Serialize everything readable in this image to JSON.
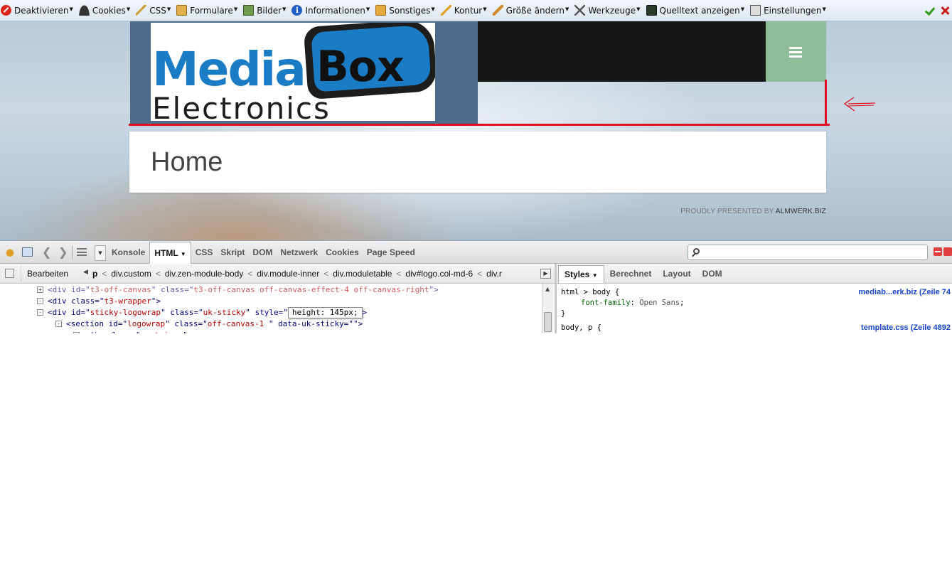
{
  "webdev_toolbar": {
    "items": [
      {
        "label": "Deaktivieren",
        "icon": "disable-icon"
      },
      {
        "label": "Cookies",
        "icon": "cookie-icon"
      },
      {
        "label": "CSS",
        "icon": "css-wand-icon"
      },
      {
        "label": "Formulare",
        "icon": "form-icon"
      },
      {
        "label": "Bilder",
        "icon": "image-icon"
      },
      {
        "label": "Informationen",
        "icon": "info-icon"
      },
      {
        "label": "Sonstiges",
        "icon": "misc-icon"
      },
      {
        "label": "Kontur",
        "icon": "pencil-icon"
      },
      {
        "label": "Größe ändern",
        "icon": "resize-icon"
      },
      {
        "label": "Werkzeuge",
        "icon": "tools-icon"
      },
      {
        "label": "Quelltext anzeigen",
        "icon": "source-icon"
      },
      {
        "label": "Einstellungen",
        "icon": "options-icon"
      }
    ]
  },
  "page": {
    "logo": {
      "word1": "Media",
      "word2": "Box",
      "word3": "Electronics"
    },
    "menu_icon": "hamburger-icon",
    "home_title": "Home",
    "footer_prefix": "PROUDLY PRESENTED BY ",
    "footer_link": "ALMWERK.BIZ",
    "colors": {
      "logo_bg": "#4d6b8b",
      "nav_bg": "#161616",
      "menu_bg": "#8fbd9a",
      "annotation": "#e0111f",
      "logo_blue": "#1b7cc6"
    }
  },
  "firebug": {
    "tabs": [
      "Konsole",
      "HTML",
      "CSS",
      "Skript",
      "DOM",
      "Netzwerk",
      "Cookies",
      "Page Speed"
    ],
    "selected_tab": "HTML",
    "search": {
      "value": "",
      "placeholder": ""
    },
    "edit_button": "Bearbeiten",
    "breadcrumbs": [
      "p",
      "div.custom",
      "div.zen-module-body",
      "div.module-inner",
      "div.moduletable",
      "div#logo.col-md-6",
      "div.r"
    ],
    "html_tree": [
      {
        "indent": 0,
        "toggle": "+",
        "tag": "div",
        "attrs": [
          [
            "id",
            "t3-off-canvas"
          ],
          [
            "class",
            "t3-off-canvas off-canvas-effect-4 off-canvas-right"
          ]
        ]
      },
      {
        "indent": 0,
        "toggle": "-",
        "tag": "div",
        "attrs": [
          [
            "class",
            "t3-wrapper"
          ]
        ]
      },
      {
        "indent": 1,
        "toggle": "-",
        "tag": "div",
        "attrs": [
          [
            "id",
            "sticky-logowrap"
          ],
          [
            "class",
            "uk-sticky"
          ]
        ],
        "edit_attr": "style",
        "edit_value": "height: 145px;"
      },
      {
        "indent": 2,
        "toggle": "-",
        "tag": "section",
        "attrs": [
          [
            "id",
            "logowrap"
          ],
          [
            "class",
            "off-canvas-1 "
          ],
          [
            "data-uk-sticky",
            ""
          ]
        ]
      },
      {
        "indent": 3,
        "toggle": "-",
        "tag": "div",
        "attrs": [
          [
            "class",
            "container"
          ]
        ]
      }
    ],
    "side_tabs": [
      "Styles",
      "Berechnet",
      "Layout",
      "DOM"
    ],
    "styles": [
      {
        "selector": "html > body {",
        "source": "mediab...erk.biz (Zeile 74",
        "props": [
          {
            "name": "font-family",
            "value": "Open Sans"
          }
        ]
      },
      {
        "selector": "body, p {",
        "source": "template.css (Zeile 4892"
      }
    ]
  }
}
